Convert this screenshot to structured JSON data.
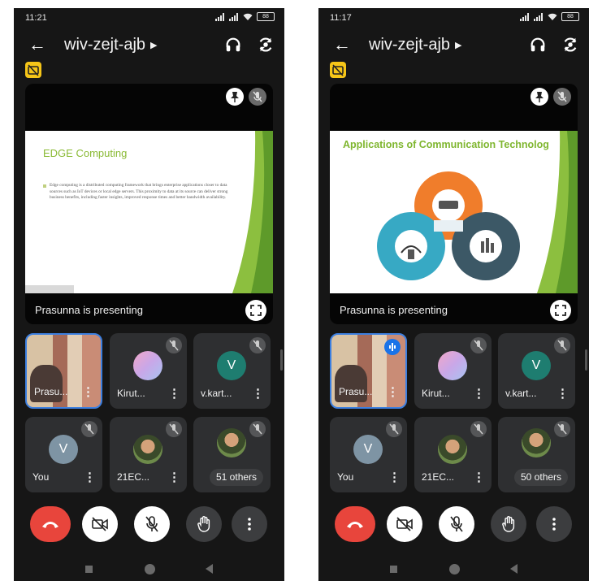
{
  "screens": [
    {
      "status_time": "11:21",
      "battery": "88",
      "meeting_code": "wiv-zejt-ajb",
      "slide": {
        "kind": "edge",
        "title": "EDGE Computing",
        "body": "Edge computing is a distributed computing framework that brings enterprise applications closer to data sources such as IoT devices or local edge servers. This proximity to data at its source can deliver strong business benefits, including faster insights, improved response times and better bandwidth availability."
      },
      "presenting_label": "Prasunna is presenting",
      "tiles": [
        {
          "name": "Prasu...",
          "avatar": "",
          "kind": "self-video"
        },
        {
          "name": "Kirut...",
          "avatar": "",
          "kind": "gradient"
        },
        {
          "name": "v.kart...",
          "avatar": "V",
          "kind": "green"
        },
        {
          "name": "You",
          "avatar": "V",
          "kind": "grey"
        },
        {
          "name": "21EC...",
          "avatar": "",
          "kind": "photo"
        },
        {
          "name": "51 others",
          "avatar": "",
          "kind": "others"
        }
      ]
    },
    {
      "status_time": "11:17",
      "battery": "88",
      "meeting_code": "wiv-zejt-ajb",
      "slide": {
        "kind": "apps",
        "title": "Applications of  Communication Technolog",
        "body": ""
      },
      "presenting_label": "Prasunna is presenting",
      "tiles": [
        {
          "name": "Prasu...",
          "avatar": "",
          "kind": "self-video"
        },
        {
          "name": "Kirut...",
          "avatar": "",
          "kind": "gradient"
        },
        {
          "name": "v.kart...",
          "avatar": "V",
          "kind": "green"
        },
        {
          "name": "You",
          "avatar": "V",
          "kind": "grey"
        },
        {
          "name": "21EC...",
          "avatar": "",
          "kind": "photo"
        },
        {
          "name": "50 others",
          "avatar": "",
          "kind": "others"
        }
      ]
    }
  ],
  "icons": {
    "back": "back-arrow-icon",
    "audio": "headphones-icon",
    "switch_camera": "switch-camera-icon",
    "captions": "captions-off-icon",
    "pin": "pin-icon",
    "mic_off": "mic-off-icon",
    "fullscreen": "fullscreen-icon",
    "end_call": "end-call-icon",
    "camera_off": "camera-off-icon",
    "raise_hand": "raise-hand-icon",
    "more": "more-vert-icon"
  },
  "colors": {
    "background": "#161616",
    "tile": "#2e2f31",
    "end_call": "#e8453c",
    "accent": "#1a73e8",
    "captions": "#f5c518",
    "slide_title": "#8aba35"
  }
}
